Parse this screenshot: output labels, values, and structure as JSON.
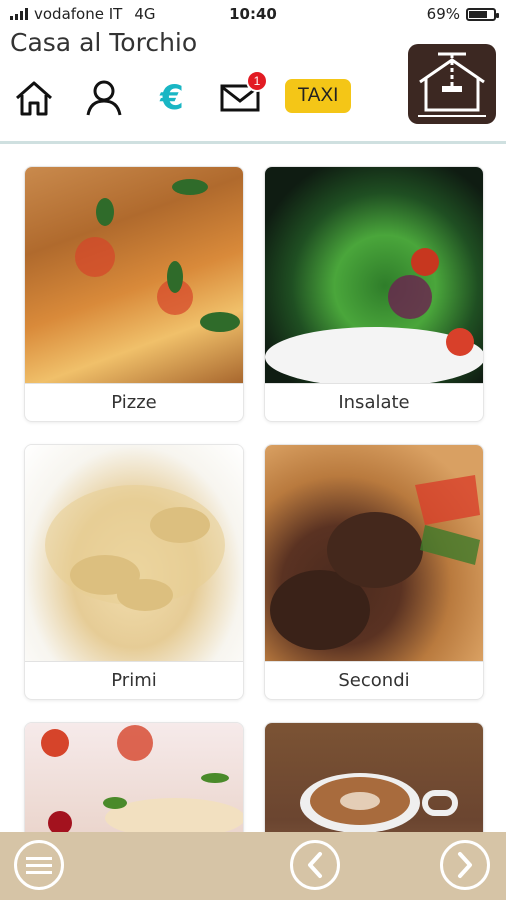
{
  "status": {
    "carrier": "vodafone IT",
    "network": "4G",
    "time": "10:40",
    "battery": "69%",
    "battery_level": 0.69
  },
  "header": {
    "title": "Casa al Torchio",
    "taxi_label": "TAXI",
    "mail_badge": "1",
    "euro_symbol": "€"
  },
  "icons": [
    "home-icon",
    "user-icon",
    "euro-icon",
    "mail-icon",
    "taxi-button",
    "logo"
  ],
  "categories": [
    {
      "label": "Pizze"
    },
    {
      "label": "Insalate"
    },
    {
      "label": "Primi"
    },
    {
      "label": "Secondi"
    },
    {
      "label": ""
    },
    {
      "label": ""
    }
  ],
  "colors": {
    "accent": "#19b6c4",
    "bottom_bar": "#d6c4a6",
    "badge": "#e21b23",
    "taxi": "#f4c617",
    "logo_bg": "#3c2822"
  }
}
